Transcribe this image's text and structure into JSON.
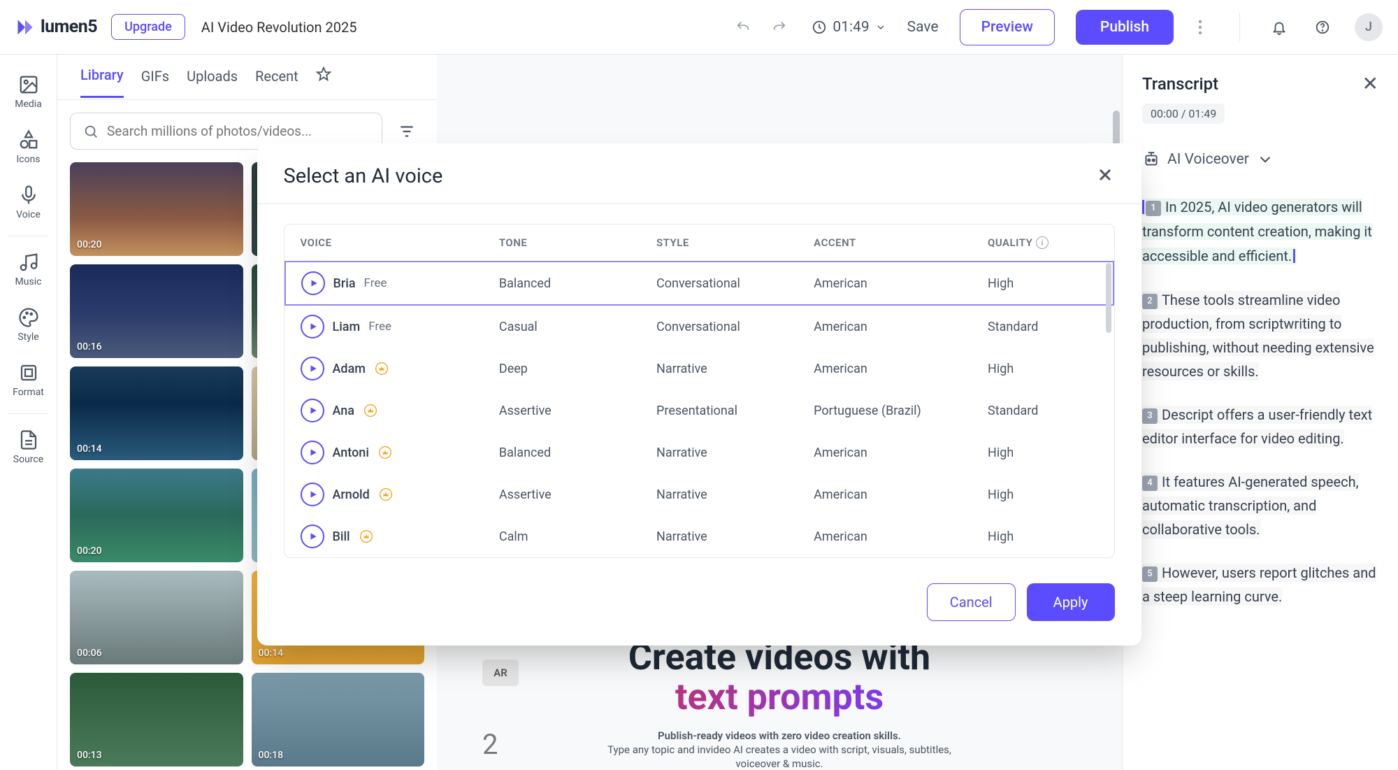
{
  "header": {
    "logo_text": "lumen5",
    "upgrade": "Upgrade",
    "project_title": "AI Video Revolution 2025",
    "duration": "01:49",
    "save": "Save",
    "preview": "Preview",
    "publish": "Publish",
    "avatar_initial": "J"
  },
  "rail": {
    "media": "Media",
    "icons": "Icons",
    "voice": "Voice",
    "music": "Music",
    "style": "Style",
    "format": "Format",
    "source": "Source"
  },
  "media_panel": {
    "tabs": {
      "library": "Library",
      "gifs": "GIFs",
      "uploads": "Uploads",
      "recent": "Recent"
    },
    "search_placeholder": "Search millions of photos/videos...",
    "thumbs": [
      {
        "dur": "00:20"
      },
      {
        "dur": ""
      },
      {
        "dur": "00:16"
      },
      {
        "dur": ""
      },
      {
        "dur": "00:14"
      },
      {
        "dur": ""
      },
      {
        "dur": "00:20"
      },
      {
        "dur": ""
      },
      {
        "dur": "00:06"
      },
      {
        "dur": "00:14"
      },
      {
        "dur": "00:13"
      },
      {
        "dur": "00:18"
      }
    ]
  },
  "canvas": {
    "ar": "AR",
    "num": "2",
    "heading_line1": "Create videos with",
    "heading_line2": "text prompts",
    "sub1": "Publish-ready videos with zero video creation skills.",
    "sub2": "Type any topic and invideo AI creates a video with script, visuals, subtitles,",
    "sub3": "voiceover & music."
  },
  "transcript": {
    "title": "Transcript",
    "time": "00:00 / 01:49",
    "voiceover": "AI Voiceover",
    "blocks": [
      {
        "num": "1",
        "text": "In 2025, AI video generators will transform content creation, making it accessible and efficient."
      },
      {
        "num": "2",
        "text": "These tools streamline video production, from scriptwriting to publishing, without needing extensive resources or skills."
      },
      {
        "num": "3",
        "text": "Descript offers a user-friendly text editor interface for video editing."
      },
      {
        "num": "4",
        "text": "It features AI-generated speech, automatic transcription, and collaborative tools."
      },
      {
        "num": "5",
        "text": "However, users report glitches and a steep learning curve."
      }
    ]
  },
  "modal": {
    "title": "Select an AI voice",
    "columns": {
      "voice": "VOICE",
      "tone": "TONE",
      "style": "STYLE",
      "accent": "ACCENT",
      "quality": "QUALITY"
    },
    "free_label": "Free",
    "voices": [
      {
        "name": "Bria",
        "badge": "free",
        "tone": "Balanced",
        "style": "Conversational",
        "accent": "American",
        "quality": "High",
        "selected": true
      },
      {
        "name": "Liam",
        "badge": "free",
        "tone": "Casual",
        "style": "Conversational",
        "accent": "American",
        "quality": "Standard"
      },
      {
        "name": "Adam",
        "badge": "premium",
        "tone": "Deep",
        "style": "Narrative",
        "accent": "American",
        "quality": "High"
      },
      {
        "name": "Ana",
        "badge": "premium",
        "tone": "Assertive",
        "style": "Presentational",
        "accent": "Portuguese (Brazil)",
        "quality": "Standard"
      },
      {
        "name": "Antoni",
        "badge": "premium",
        "tone": "Balanced",
        "style": "Narrative",
        "accent": "American",
        "quality": "High"
      },
      {
        "name": "Arnold",
        "badge": "premium",
        "tone": "Assertive",
        "style": "Narrative",
        "accent": "American",
        "quality": "High"
      },
      {
        "name": "Bill",
        "badge": "premium",
        "tone": "Calm",
        "style": "Narrative",
        "accent": "American",
        "quality": "High"
      }
    ],
    "cancel": "Cancel",
    "apply": "Apply"
  }
}
